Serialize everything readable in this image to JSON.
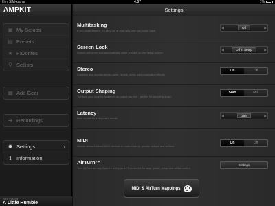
{
  "status_bar": {
    "carrier": "Нет SIM-карты",
    "time": "4:57",
    "battery": "1%"
  },
  "sidebar": {
    "brand": "AMPKIT",
    "groups": [
      {
        "items": [
          {
            "label": "My Setups",
            "icon": "folder-icon"
          },
          {
            "label": "Presets",
            "icon": "presets-icon"
          },
          {
            "label": "Favorites",
            "icon": "star-icon"
          },
          {
            "label": "Setlists",
            "icon": "setlist-icon"
          }
        ]
      },
      {
        "items": [
          {
            "label": "Add Gear",
            "icon": "add-gear-icon"
          }
        ]
      },
      {
        "items": [
          {
            "label": "Recordings",
            "icon": "recording-icon"
          }
        ]
      },
      {
        "items": [
          {
            "label": "Settings",
            "icon": "gear-icon",
            "active": true
          },
          {
            "label": "Information",
            "icon": "info-icon"
          }
        ]
      }
    ],
    "now_playing": {
      "label": "Now Playing",
      "preset": "A Little Rumble"
    }
  },
  "main": {
    "title": "Settings",
    "settings": [
      {
        "name": "Multitasking",
        "desc": "If you close AmpKit, it'll stay out of your way until you come back.",
        "control": "stepper",
        "value": "Off"
      },
      {
        "name": "Screen Lock",
        "desc": "Screen will never lock automatically while you are on the Setup screen.",
        "control": "stepper",
        "value": "Off in Setup"
      },
      {
        "name": "Stereo",
        "desc": "Combine and records stereo pairs, reverb, delay, and modulation effects.",
        "control": "toggle",
        "options": [
          "On",
          "Off"
        ],
        "selected": "On"
      },
      {
        "name": "Output Shaping",
        "desc": "Tightens your tone by adding in an output low end - perfect for pinching down.",
        "control": "toggle",
        "options": [
          "Solo",
          "Mix"
        ],
        "selected": "Solo"
      },
      {
        "name": "Latency",
        "desc": "Best choice for everyone's needs.",
        "control": "stepper",
        "value": "256"
      },
      {
        "name": "MIDI",
        "desc": "Allows network-based MIDI devices to control amps, pedals, setups and setlists.",
        "control": "toggle",
        "options": [
          "On",
          "Off"
        ],
        "selected": "On"
      },
      {
        "name": "AirTurn™",
        "desc": "Turn AirTurn on only if you're using an AirTurn device for amp, pedal, setup and setlist control.",
        "control": "button",
        "value": "Settings"
      }
    ],
    "midi_button": "MIDI & AirTurn Mappings"
  }
}
